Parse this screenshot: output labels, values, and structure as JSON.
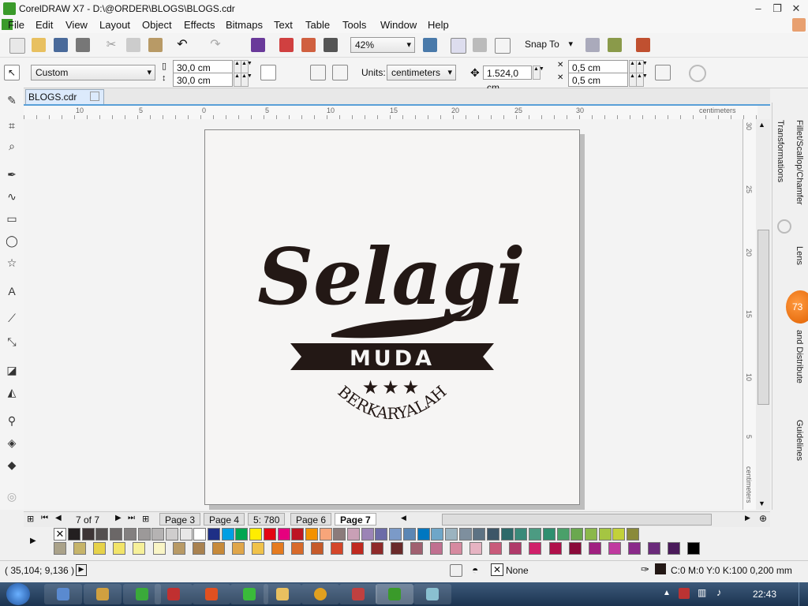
{
  "window": {
    "title": "CorelDRAW X7 - D:\\@ORDER\\BLOGS\\BLOGS.cdr"
  },
  "menu": [
    "File",
    "Edit",
    "View",
    "Layout",
    "Object",
    "Effects",
    "Bitmaps",
    "Text",
    "Table",
    "Tools",
    "Window",
    "Help"
  ],
  "toolbar": {
    "zoom": "42%",
    "snap_to": "Snap To"
  },
  "property_bar": {
    "page_size": "Custom",
    "width": "30,0 cm",
    "height": "30,0 cm",
    "units_label": "Units:",
    "units": "centimeters",
    "nudge": "1.524,0 cm",
    "dup_x": "0,5 cm",
    "dup_y": "0,5 cm"
  },
  "document_tab": "BLOGS.cdr",
  "ruler": {
    "unit": "centimeters",
    "h_labels": [
      "10",
      "5",
      "0",
      "5",
      "10",
      "15",
      "20",
      "25",
      "30"
    ],
    "v_labels": [
      "30",
      "25",
      "20",
      "15",
      "10",
      "5"
    ]
  },
  "artwork": {
    "headline": "Selagi",
    "banner": "MUDA",
    "arc_text": "BERKARYALAH",
    "stars": "★★★"
  },
  "dockers": {
    "tabs": [
      "Transformations",
      "Fillet/Scallop/Chamfer",
      "Lens",
      "and Distribute",
      "Guidelines"
    ],
    "badge": "73"
  },
  "page_nav": {
    "counter": "7 of 7",
    "tabs": [
      "Page 3",
      "Page 4",
      "5: 780",
      "Page 6",
      "Page 7"
    ],
    "active": "Page 7"
  },
  "palette": {
    "row1": [
      "#231f20",
      "#3d3536",
      "#545050",
      "#6b6767",
      "#838080",
      "#9c9999",
      "#b5b3b3",
      "#cfcdcd",
      "#e8e7e7",
      "#ffffff",
      "#1e2f86",
      "#009fe3",
      "#00a651",
      "#ffed00",
      "#e30613",
      "#e6007e",
      "#bd1622",
      "#f39200",
      "#f7a57a",
      "#8b7b7b",
      "#c9a0b6",
      "#9b84b6",
      "#6c6ca8",
      "#7b9ac8",
      "#5b86b4",
      "#0077c0",
      "#6ea6c8",
      "#9bb3c0",
      "#7e8f9e",
      "#5d7283",
      "#3d5668",
      "#2d6a6a",
      "#3a8a7a",
      "#4c9b82",
      "#2f8f6f",
      "#4aa06a",
      "#6aa84f",
      "#8bb84a",
      "#a5c542",
      "#c2d13a",
      "#8a8a3a"
    ],
    "row2": [
      "#aaa28a",
      "#c6b46a",
      "#e6d24a",
      "#f2e46a",
      "#f6f09a",
      "#f9f5c6",
      "#b89a66",
      "#a98250",
      "#c78a3a",
      "#e0a64a",
      "#f0c24a",
      "#e57b1f",
      "#d86a2a",
      "#c65a2a",
      "#d4462a",
      "#c02a20",
      "#8f2a2a",
      "#6a2a2a",
      "#a06070",
      "#c07090",
      "#d68aa0",
      "#e6b3c2",
      "#c95a7a",
      "#b03a6a",
      "#d0206a",
      "#b0104a",
      "#8a0a3a",
      "#a02080",
      "#c03aa0",
      "#8a2a8a",
      "#6a2a7a",
      "#4a1a5a",
      "#000000"
    ]
  },
  "status": {
    "coords": "( 35,104; 9,136 )",
    "fill": "None",
    "outline": "C:0 M:0 Y:0 K:100  0,200 mm"
  },
  "taskbar": {
    "clock": "22:43"
  },
  "colors": {
    "ink": "#231815",
    "accent": "#5aa0d8"
  }
}
